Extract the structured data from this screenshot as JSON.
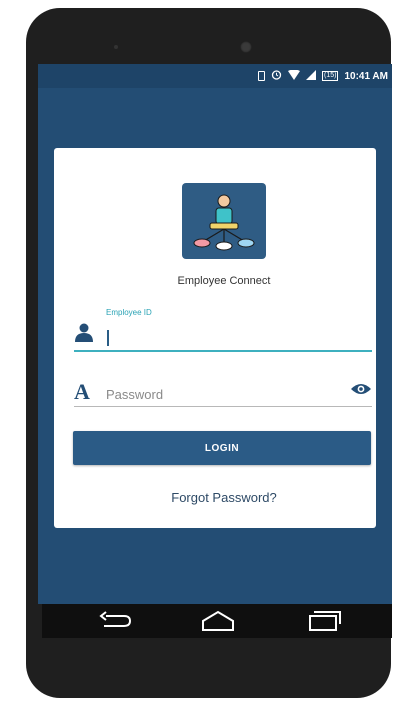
{
  "status_bar": {
    "battery": "(15)",
    "time": "10:41 AM"
  },
  "app": {
    "name": "Employee Connect",
    "logo_icon": "employee-network-icon",
    "colors": {
      "primary": "#2b5b86",
      "background": "#234d74",
      "accent": "#3db0bf"
    }
  },
  "login_form": {
    "employee_id": {
      "label": "Employee ID",
      "value": "",
      "icon": "user-icon"
    },
    "password": {
      "placeholder": "Password",
      "value": "",
      "icon": "letter-a-icon",
      "toggle_icon": "eye-icon",
      "letter_glyph": "A"
    },
    "login_label": "LOGIN",
    "forgot_label": "Forgot Password?"
  },
  "nav_bar": {
    "buttons": [
      "back-icon",
      "home-icon",
      "recent-apps-icon"
    ]
  }
}
